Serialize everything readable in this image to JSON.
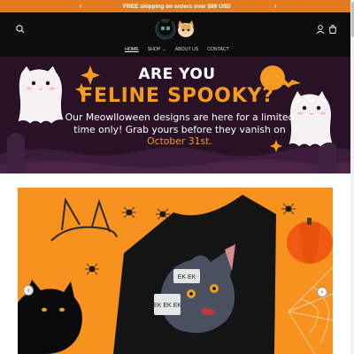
{
  "announcement": {
    "text": "FREE shipping on orders over $99 USD",
    "prev_icon": "chevron-left-icon",
    "next_icon": "chevron-right-icon"
  },
  "header": {
    "search_icon": "search-icon",
    "account_icon": "account-icon",
    "cart_icon": "cart-icon",
    "logo": "cat-logo"
  },
  "nav": {
    "items": [
      {
        "label": "HOME",
        "active": true
      },
      {
        "label": "SHOP",
        "dropdown": true
      },
      {
        "label": "ABOUT US"
      },
      {
        "label": "CONTACT"
      }
    ]
  },
  "hero": {
    "line1": "ARE YOU",
    "line2": "FELINE SPOOKY?",
    "body": "Our Meowlloween designs are here for a limited time only! Grab yours before they vanish on",
    "date": "October 31st.",
    "colors": {
      "background": "#2a1226",
      "accent": "#f39a22"
    }
  },
  "product": {
    "bubble_1": "EK EK",
    "bubble_2": "EK EK EK",
    "colors": {
      "background": "#f7921f"
    }
  }
}
